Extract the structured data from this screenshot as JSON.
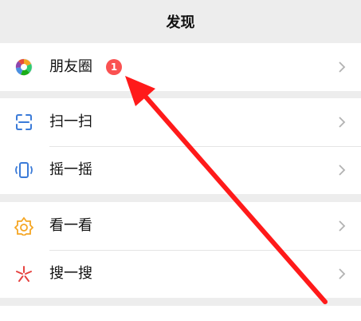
{
  "header": {
    "title": "发现"
  },
  "groups": [
    {
      "items": [
        {
          "label": "朋友圈",
          "icon": "moments-icon",
          "badge": "1"
        }
      ]
    },
    {
      "items": [
        {
          "label": "扫一扫",
          "icon": "scan-icon"
        },
        {
          "label": "摇一摇",
          "icon": "shake-icon"
        }
      ]
    },
    {
      "items": [
        {
          "label": "看一看",
          "icon": "top-stories-icon"
        },
        {
          "label": "搜一搜",
          "icon": "search-icon"
        }
      ]
    }
  ],
  "colors": {
    "background": "#ededed",
    "row_background": "#ffffff",
    "badge": "#fa5151",
    "annotation_arrow": "#ff1a1a",
    "chevron": "#b2b2b2"
  }
}
